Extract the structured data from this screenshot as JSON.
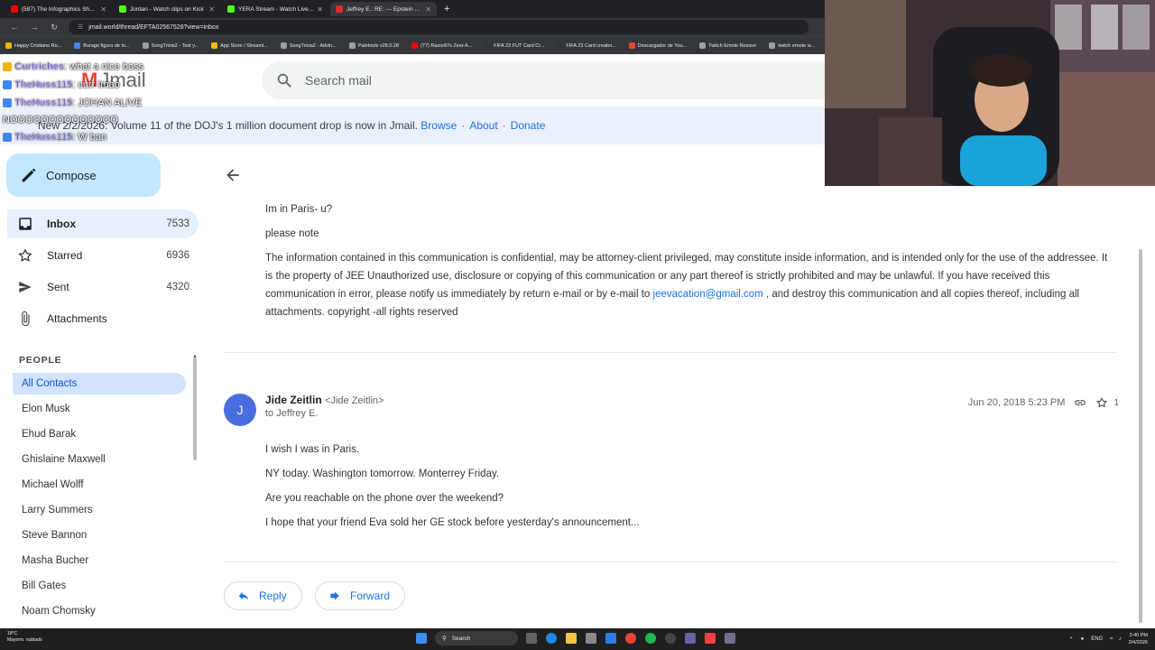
{
  "browser": {
    "tabs": [
      {
        "title": "(587) The Infographics Show -",
        "color": "#ff0000",
        "active": false
      },
      {
        "title": "Jordan - Watch clips on Kick",
        "color": "#53fc18",
        "active": false
      },
      {
        "title": "YERA Stream - Watch Live on K",
        "color": "#53fc18",
        "active": false
      },
      {
        "title": "Jeffrey E.: RE: --- Epstein Emails",
        "color": "#d93025",
        "active": true
      }
    ],
    "new_tab": "+",
    "url": "jmail.world/thread/EFTA02567528?view=inbox",
    "bookmarks": [
      {
        "label": "Happy Cristiano Ro...",
        "color": "#f4b400"
      },
      {
        "label": "Burago figura de to...",
        "color": "#4285f4"
      },
      {
        "label": "SongTrivia2 - Test y...",
        "color": "#9aa0a6"
      },
      {
        "label": "App Store / Streami...",
        "color": "#fbbc04"
      },
      {
        "label": "SongTrivia2 - Advin...",
        "color": "#9aa0a6"
      },
      {
        "label": "Paletools v28.0.28",
        "color": "#9aa0a6"
      },
      {
        "label": "(77) Razor87s Zest-A...",
        "color": "#ff0000"
      },
      {
        "label": "FIFA 23 FUT Card Cr...",
        "color": "#333333"
      },
      {
        "label": "FIFA 23 Card creator...",
        "color": "#333333"
      },
      {
        "label": "Descargador de You...",
        "color": "#ea4335"
      },
      {
        "label": "Twitch Emote Resizer",
        "color": "#9aa0a6"
      },
      {
        "label": "twitch emote w...",
        "color": "#9aa0a6"
      }
    ]
  },
  "chat_overlay": [
    {
      "user": "Curtriches",
      "message": ": what a nice boss"
    },
    {
      "user": "TheHuss115",
      "message": ": curr Imao"
    },
    {
      "user": "TheHuss115",
      "message": ": JOHAN ALIVE"
    },
    {
      "user": "",
      "message": "NOOOOOOOOOOOOOO"
    },
    {
      "user": "TheHuss115",
      "message": ": W ban"
    }
  ],
  "app": {
    "logo_text": "Jmail",
    "search_placeholder": "Search mail",
    "banner": {
      "text": "New 2/2/2026: Volume 11 of the DOJ's 1 million document drop is now in Jmail.",
      "links": [
        "Browse",
        "About",
        "Donate"
      ]
    }
  },
  "sidebar": {
    "compose_label": "Compose",
    "nav": [
      {
        "label": "Inbox",
        "count": "7533",
        "icon": "inbox-icon",
        "active": true
      },
      {
        "label": "Starred",
        "count": "6936",
        "icon": "star-icon",
        "active": false
      },
      {
        "label": "Sent",
        "count": "4320",
        "icon": "send-icon",
        "active": false
      },
      {
        "label": "Attachments",
        "count": "",
        "icon": "paperclip-icon",
        "active": false
      }
    ],
    "people_heading": "PEOPLE",
    "contacts": [
      "All Contacts",
      "Elon Musk",
      "Ehud Barak",
      "Ghislaine Maxwell",
      "Michael Wolff",
      "Larry Summers",
      "Steve Bannon",
      "Masha Bucher",
      "Bill Gates",
      "Noam Chomsky"
    ]
  },
  "thread": {
    "prev_message": {
      "lines": [
        "Im in Paris- u?",
        "please note"
      ],
      "disclaimer_before": "The information contained in this communication is confidential, may be attorney-client privileged, may constitute inside information, and is intended only for the use of the addressee. It is the property of JEE Unauthorized use, disclosure or copying of this communication or any part thereof is strictly prohibited and may be unlawful. If you have received this communication in error, please notify us immediately by return e-mail or by e-mail to",
      "disclaimer_link": "jeevacation@gmail.com",
      "disclaimer_after": ", and destroy this communication and all copies thereof, including all attachments. copyright -all rights reserved"
    },
    "message": {
      "avatar_letter": "J",
      "sender_name": "Jide Zeitlin",
      "sender_email": "<Jide Zeitlin>",
      "to": "to Jeffrey E.",
      "date": "Jun 20, 2018 5:23 PM",
      "star_count": "1",
      "lines": [
        "I wish I was in Paris.",
        "NY today. Washington tomorrow. Monterrey Friday.",
        "Are you reachable on the phone over the weekend?",
        "I hope that your friend Eva sold her GE stock before yesterday's announcement..."
      ]
    },
    "reply_label": "Reply",
    "forward_label": "Forward"
  },
  "taskbar": {
    "weather_temp": "18°C",
    "weather_desc": "Mayorm. nublado",
    "search_label": "Search",
    "lang": "ENG",
    "time": "3:40 PM",
    "date": "2/4/2026"
  },
  "colors": {
    "accent": "#1a73e8",
    "compose_bg": "#c2e7ff",
    "active_nav_bg": "#e8f0fe",
    "avatar_bg": "#4a6ee0"
  }
}
